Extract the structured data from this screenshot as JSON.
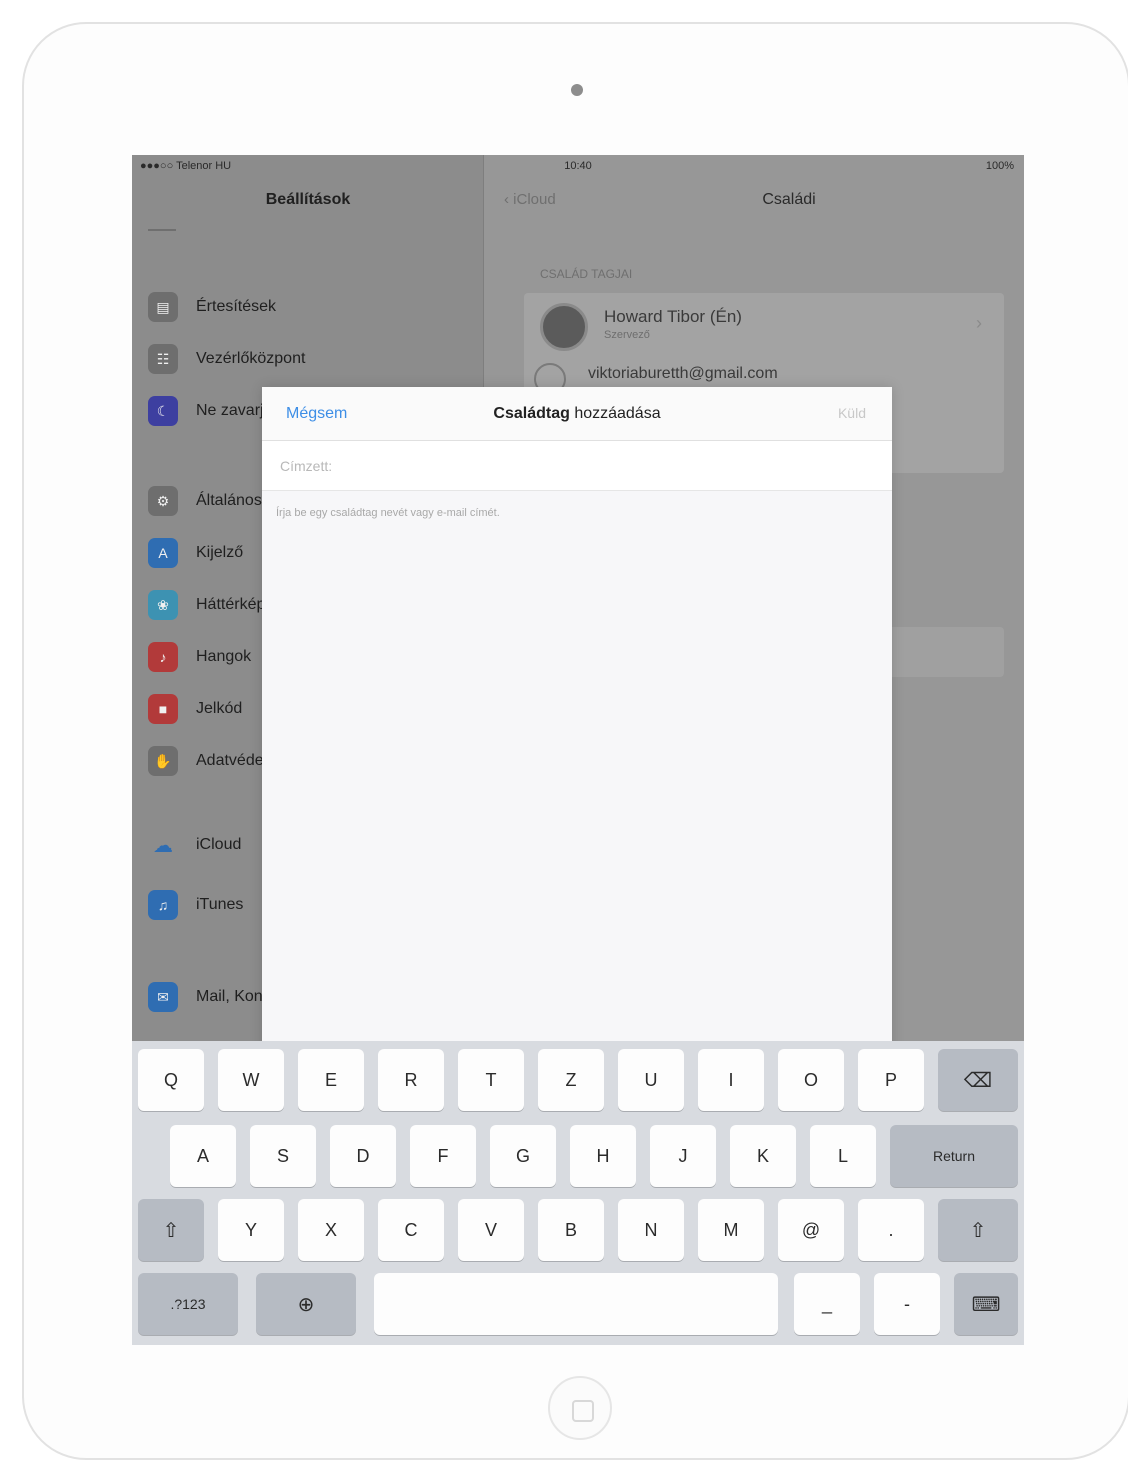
{
  "status_bar": {
    "carrier": "●●●○○ Telenor HU",
    "time": "10:40",
    "battery": "100%"
  },
  "settings": {
    "title": "Beállítások",
    "items": [
      {
        "label": "Értesítések",
        "icon": "notifications-icon",
        "color": "#6e6e6e"
      },
      {
        "label": "Vezérlőközpont",
        "icon": "control-center-icon",
        "color": "#6e6e6e"
      },
      {
        "label": "Ne zavarjanak",
        "icon": "moon-icon",
        "color": "#3d3fa0"
      },
      {
        "label": "Általános",
        "icon": "gear-icon",
        "color": "#6e6e6e"
      },
      {
        "label": "Kijelző",
        "icon": "display-icon",
        "color": "#2f6db2"
      },
      {
        "label": "Háttérkép",
        "icon": "wallpaper-icon",
        "color": "#3d92b2"
      },
      {
        "label": "Hangok",
        "icon": "sound-icon",
        "color": "#b23a3a"
      },
      {
        "label": "Jelkód",
        "icon": "lock-icon",
        "color": "#b23a3a"
      },
      {
        "label": "Adatvédelem",
        "icon": "hand-icon",
        "color": "#6e6e6e"
      },
      {
        "label": "iCloud",
        "icon": "cloud-icon",
        "color": "#2f6db2"
      },
      {
        "label": "iTunes",
        "icon": "store-icon",
        "color": "#2f6db2"
      },
      {
        "label": "Mail, Kontaktok",
        "icon": "mail-icon",
        "color": "#2f6db2"
      }
    ]
  },
  "detail": {
    "back_label": "iCloud",
    "title": "Családi",
    "section_label": "CSALÁD TAGJAI",
    "contact_name": "Howard Tibor (Én)",
    "contact_role": "Szervező",
    "contact_email": "viktoriaburetth@gmail.com"
  },
  "modal": {
    "cancel_label": "Mégsem",
    "title_bold": "Családtag",
    "title_rest": "hozzáadása",
    "done_label": "Küld",
    "field_placeholder": "Címzett:",
    "hint": "Írja be egy családtag nevét vagy e-mail címét."
  },
  "keyboard": {
    "row1": [
      "Q",
      "W",
      "E",
      "R",
      "T",
      "Z",
      "U",
      "I",
      "O",
      "P"
    ],
    "row2": [
      "A",
      "S",
      "D",
      "F",
      "G",
      "H",
      "J",
      "K",
      "L"
    ],
    "row3": [
      "Y",
      "X",
      "C",
      "V",
      "B",
      "N",
      "M",
      "@",
      "."
    ],
    "return_label": "Return",
    "numbers_label": ".?123",
    "underscore_label": "_",
    "dash_label": "-",
    "space_label": "",
    "hide_label": "⌨"
  }
}
